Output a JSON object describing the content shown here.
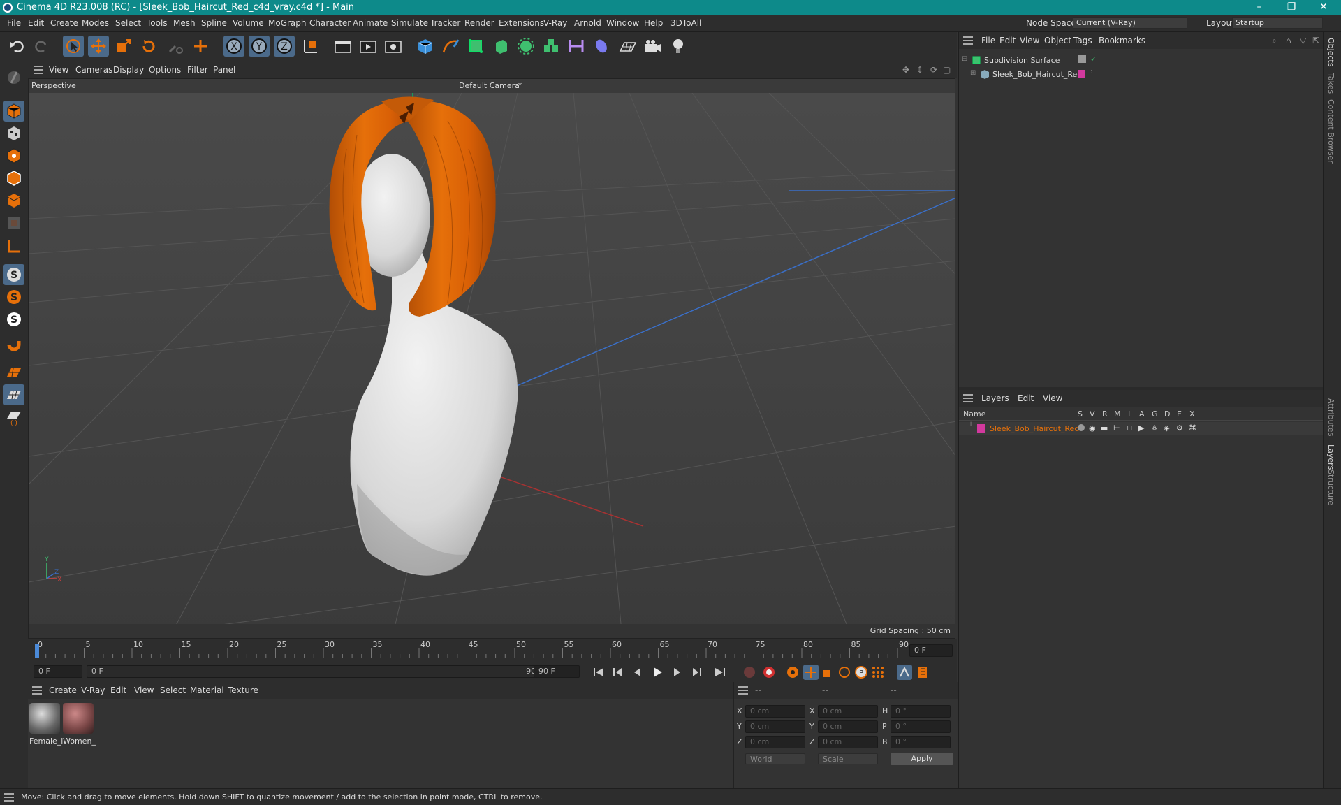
{
  "window": {
    "title": "Cinema 4D R23.008 (RC) - [Sleek_Bob_Haircut_Red_c4d_vray.c4d *] - Main",
    "minimize": "–",
    "restore": "❐",
    "close": "✕"
  },
  "menu": [
    "File",
    "Edit",
    "Create",
    "Modes",
    "Select",
    "Tools",
    "Mesh",
    "Spline",
    "Volume",
    "MoGraph",
    "Character",
    "Animate",
    "Simulate",
    "Tracker",
    "Render",
    "Extensions",
    "V-Ray",
    "Arnold",
    "Window",
    "Help",
    "3DToAll"
  ],
  "nodespace": {
    "label": "Node Space:",
    "value": "Current (V-Ray)"
  },
  "layout": {
    "label": "Layout:",
    "value": "Startup"
  },
  "toolbar_axes": [
    "X",
    "Y",
    "Z"
  ],
  "viewport": {
    "menu": [
      "View",
      "Cameras",
      "Display",
      "Options",
      "Filter",
      "Panel"
    ],
    "projection": "Perspective",
    "camera": "Default Camera",
    "camera_mark": ":*",
    "grid_spacing": "Grid Spacing : 50 cm",
    "axis_x": "X",
    "axis_y": "Y",
    "axis_z": "Z"
  },
  "timeline": {
    "ticks": [
      "0",
      "5",
      "10",
      "15",
      "20",
      "25",
      "30",
      "35",
      "40",
      "45",
      "50",
      "55",
      "60",
      "65",
      "70",
      "75",
      "80",
      "85",
      "90"
    ],
    "current": "0 F"
  },
  "transport": {
    "start": "0 F",
    "range_start": "0 F",
    "range_end": "90 F",
    "end": "90 F"
  },
  "materials": {
    "menu": [
      "Create",
      "V-Ray",
      "Edit",
      "View",
      "Select",
      "Material",
      "Texture"
    ],
    "items": [
      {
        "name": "Female_l"
      },
      {
        "name": "Women_"
      }
    ]
  },
  "attributes": {
    "headers": [
      "--",
      "--",
      "--"
    ],
    "rows": [
      {
        "l1": "X",
        "v1": "0 cm",
        "l2": "X",
        "v2": "0 cm",
        "l3": "H",
        "v3": "0 °"
      },
      {
        "l1": "Y",
        "v1": "0 cm",
        "l2": "Y",
        "v2": "0 cm",
        "l3": "P",
        "v3": "0 °"
      },
      {
        "l1": "Z",
        "v1": "0 cm",
        "l2": "Z",
        "v2": "0 cm",
        "l3": "B",
        "v3": "0 °"
      }
    ],
    "coord": "World",
    "mode": "Scale",
    "apply": "Apply"
  },
  "objects": {
    "menu": [
      "File",
      "Edit",
      "View",
      "Object",
      "Tags",
      "Bookmarks"
    ],
    "items": [
      {
        "name": "Subdivision Surface"
      },
      {
        "name": "Sleek_Bob_Haircut_Red"
      }
    ]
  },
  "layers": {
    "menu": [
      "Layers",
      "Edit",
      "View"
    ],
    "columns": {
      "name": "Name",
      "flags": [
        "S",
        "V",
        "R",
        "M",
        "L",
        "A",
        "G",
        "D",
        "E",
        "X"
      ]
    },
    "items": [
      {
        "name": "Sleek_Bob_Haircut_Red",
        "color": "#d2399e"
      }
    ]
  },
  "side_tabs": [
    "Objects",
    "Takes",
    "Content Browser",
    "Attributes",
    "Layers",
    "Structure"
  ],
  "status": "Move: Click and drag to move elements. Hold down SHIFT to quantize movement / add to the selection in point mode, CTRL to remove.",
  "colors": {
    "accent": "#e6700a",
    "hair": "#d96a0c",
    "selection": "#4b6a8a",
    "layer": "#d2399e"
  }
}
